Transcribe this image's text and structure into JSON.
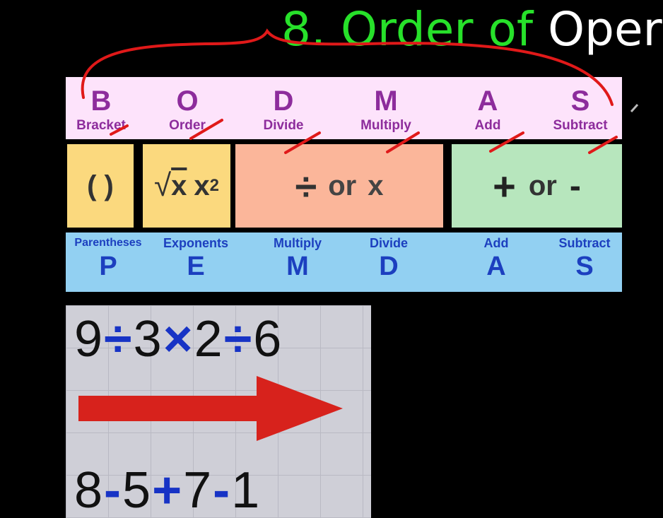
{
  "title": {
    "number": "8.",
    "green": "Order of",
    "white": "Oper"
  },
  "bodmas": [
    {
      "letter": "B",
      "word": "Bracket"
    },
    {
      "letter": "O",
      "word": "Order"
    },
    {
      "letter": "D",
      "word": "Divide"
    },
    {
      "letter": "M",
      "word": "Multiply"
    },
    {
      "letter": "A",
      "word": "Add"
    },
    {
      "letter": "S",
      "word": "Subtract"
    }
  ],
  "symbols": {
    "parentheses": "( )",
    "exponent_power": "x",
    "exponent_sup": "2",
    "root_var": "x",
    "md_divide": "÷",
    "md_or": "or",
    "md_multiply": "x",
    "as_plus": "+",
    "as_or": "or",
    "as_minus": "-"
  },
  "pemdas": [
    {
      "word": "Parentheses",
      "letter": "P"
    },
    {
      "word": "Exponents",
      "letter": "E"
    },
    {
      "word": "Multiply",
      "letter": "M"
    },
    {
      "word": "Divide",
      "letter": "D"
    },
    {
      "word": "Add",
      "letter": "A"
    },
    {
      "word": "Subtract",
      "letter": "S"
    }
  ],
  "examples": {
    "line1": [
      "9",
      "÷",
      "3",
      "×",
      "2",
      "÷",
      "6"
    ],
    "line2": [
      "8",
      "-",
      "5",
      "+",
      "7",
      "-",
      "1"
    ]
  },
  "colors": {
    "bodmas_bg": "#fde3fb",
    "pemdas_bg": "#92d0f2",
    "annotation_red": "#e01919",
    "arrow_red": "#d7221c",
    "title_green": "#27e12a"
  }
}
